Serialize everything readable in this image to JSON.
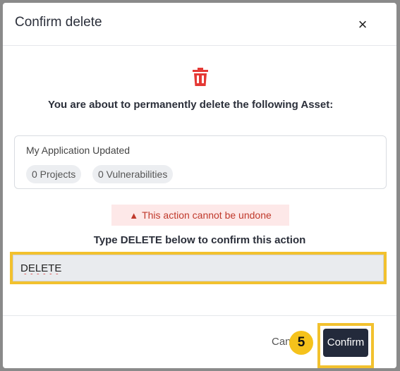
{
  "dialog": {
    "title": "Confirm delete",
    "close_label": "×"
  },
  "message": "You are about to permanently delete the following Asset:",
  "asset": {
    "name": "My Application Updated",
    "projects_chip": "0 Projects",
    "vulnerabilities_chip": "0 Vulnerabilities"
  },
  "warning": {
    "text": "This action cannot be undone",
    "icon": "warning-triangle-icon"
  },
  "confirm_prompt": "Type DELETE below to confirm this action",
  "confirm_input": {
    "value": "DELETE"
  },
  "footer": {
    "cancel_label": "Can",
    "step_badge": "5",
    "confirm_label": "Confirm"
  },
  "colors": {
    "danger": "#e53935",
    "primary_button": "#232a3b",
    "highlight": "#f2c12e",
    "warning_bg": "#fde8e8"
  }
}
